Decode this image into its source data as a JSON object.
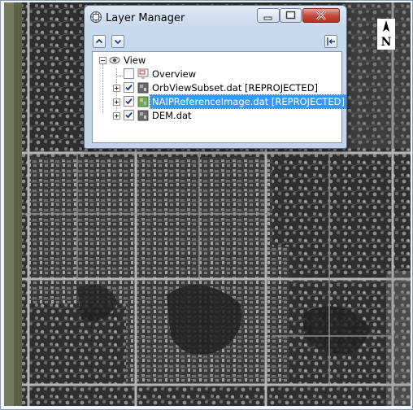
{
  "window": {
    "title": "Layer Manager",
    "controls": {
      "minimize_icon": "minimize-icon",
      "maximize_icon": "maximize-icon",
      "close_icon": "close-icon"
    }
  },
  "toolbar": {
    "buttons": [
      {
        "name": "move-up-button",
        "icon": "arrow-up-icon"
      },
      {
        "name": "move-down-button",
        "icon": "arrow-down-icon"
      },
      {
        "name": "dock-button",
        "icon": "dock-icon"
      }
    ]
  },
  "tree": {
    "root": {
      "label": "View",
      "expanded": true,
      "icon": "view-icon"
    },
    "items": [
      {
        "label": "Overview",
        "checked": false,
        "icon": "overview-icon",
        "expandable": false,
        "selected": false
      },
      {
        "label": "OrbViewSubset.dat [REPROJECTED]",
        "checked": true,
        "icon": "raster-layer-icon",
        "expandable": true,
        "selected": false
      },
      {
        "label": "NAIPReferenceImage.dat [REPROJECTED]",
        "checked": true,
        "icon": "raster-color-layer-icon",
        "expandable": true,
        "selected": true
      },
      {
        "label": "DEM.dat",
        "checked": true,
        "icon": "raster-layer-icon",
        "expandable": true,
        "selected": false
      }
    ]
  },
  "map": {
    "north_arrow_label": "N",
    "colors": {
      "selection": "#3399ff",
      "image_dark": "#2a2a2a",
      "image_light": "#9a9a9a"
    }
  }
}
